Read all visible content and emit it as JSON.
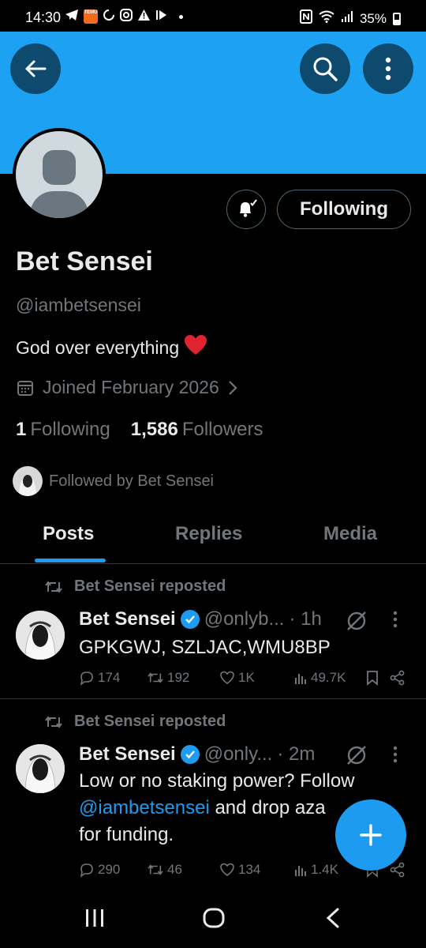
{
  "status_bar": {
    "time": "14:30",
    "temu_label": "TEMU",
    "battery": "35%"
  },
  "profile": {
    "name": "Bet Sensei",
    "handle": "@iambetsensei",
    "bio": "God over everything",
    "bio_emoji": "❤️",
    "joined": "Joined February 2026",
    "following_count": "1",
    "following_label": "Following",
    "followers_count": "1,586",
    "followers_label": "Followers",
    "followed_by": "Followed by Bet Sensei",
    "follow_button": "Following"
  },
  "tabs": [
    {
      "label": "Posts",
      "active": true
    },
    {
      "label": "Replies",
      "active": false
    },
    {
      "label": "Media",
      "active": false
    }
  ],
  "posts": [
    {
      "repost_label": "Bet Sensei reposted",
      "author": "Bet Sensei",
      "handle": "@onlyb...",
      "time": "· 1h",
      "text": "GPKGWJ, SZLJAC,WMU8BP",
      "replies": "174",
      "reposts": "192",
      "likes": "1K",
      "views": "49.7K"
    },
    {
      "repost_label": "Bet Sensei reposted",
      "author": "Bet Sensei",
      "handle": "@only...",
      "time": "· 2m",
      "text_before": "Low or no staking power? Follow",
      "mention": "@iambetsensei",
      "text_after": " and drop aza",
      "text_line3": "for funding.",
      "replies": "290",
      "reposts": "46",
      "likes": "134",
      "views": "1.4K"
    }
  ],
  "colors": {
    "banner": "#1da1f2",
    "accent": "#1d9bf0",
    "background": "#000000",
    "muted": "#71767b"
  }
}
